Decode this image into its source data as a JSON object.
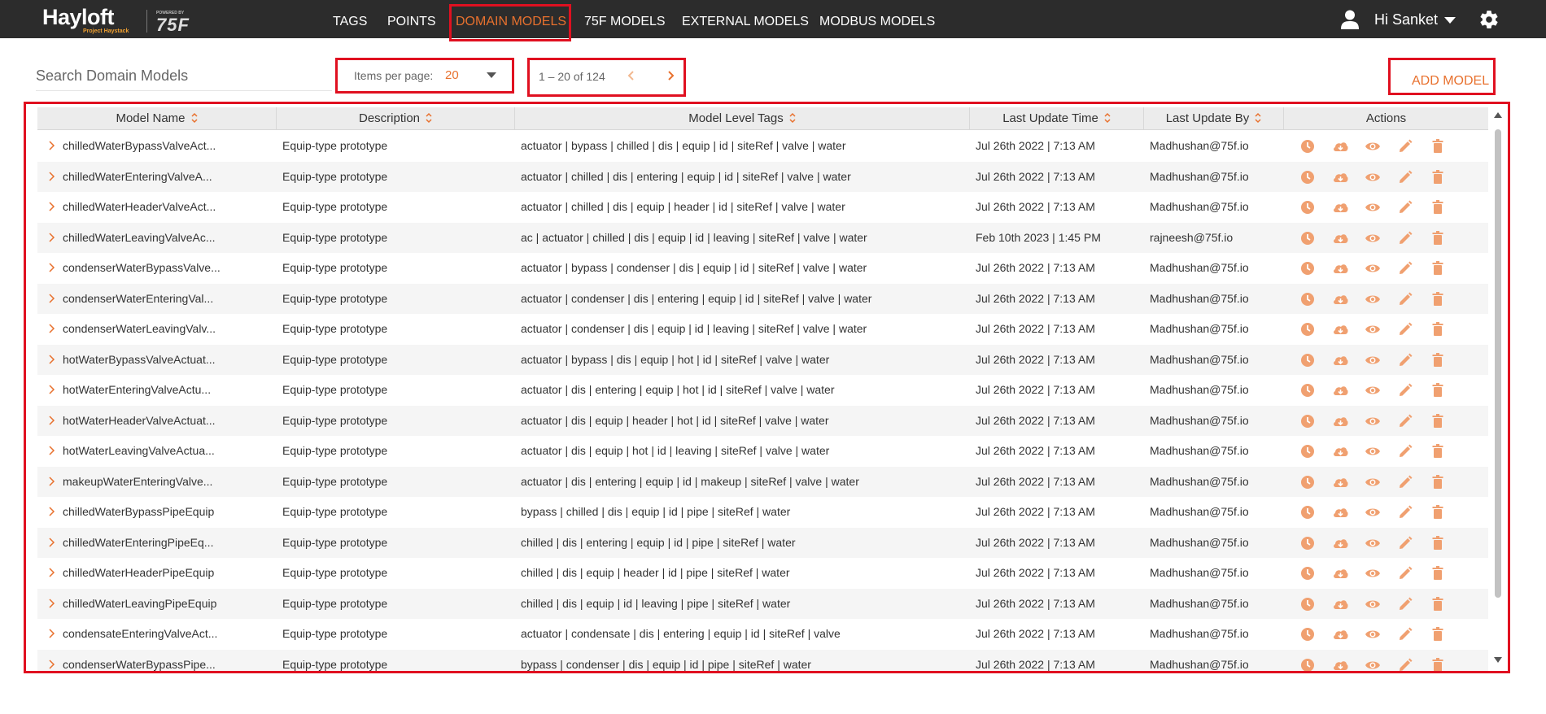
{
  "app": {
    "logo_main": "Hayloft",
    "logo_sub": "Project Haystack",
    "logo_powered": "POWERED BY",
    "logo_brand": "75F"
  },
  "nav": {
    "items": [
      {
        "label": "TAGS",
        "active": false
      },
      {
        "label": "POINTS",
        "active": false
      },
      {
        "label": "DOMAIN MODELS",
        "active": true
      },
      {
        "label": "75F MODELS",
        "active": false
      },
      {
        "label": "EXTERNAL MODELS",
        "active": false
      },
      {
        "label": "MODBUS MODELS",
        "active": false
      }
    ],
    "user_greeting": "Hi Sanket",
    "user_icon": "person-icon",
    "settings_icon": "gear-icon"
  },
  "toolbar": {
    "search_placeholder": "Search Domain Models",
    "items_per_page_label": "Items per page:",
    "items_per_page_value": "20",
    "range_label": "1 – 20 of 124",
    "add_label": "ADD MODEL"
  },
  "colors": {
    "accent": "#e8712e",
    "nav_bg": "#2c2c2c",
    "highlight": "#e01020",
    "row_alt": "#f5f5f5"
  },
  "table": {
    "columns": [
      "Model Name",
      "Description",
      "Model Level Tags",
      "Last Update Time",
      "Last Update By",
      "Actions"
    ],
    "action_icons": [
      "history-icon",
      "download-cloud-icon",
      "view-eye-icon",
      "edit-pencil-icon",
      "delete-trash-icon"
    ],
    "rows": [
      {
        "name": "chilledWaterBypassValveAct...",
        "description": "Equip-type prototype",
        "tags": "actuator | bypass | chilled | dis | equip | id | siteRef | valve | water",
        "time": "Jul 26th 2022 | 7:13 AM",
        "by": "Madhushan@75f.io"
      },
      {
        "name": "chilledWaterEnteringValveA...",
        "description": "Equip-type prototype",
        "tags": "actuator | chilled | dis | entering | equip | id | siteRef | valve | water",
        "time": "Jul 26th 2022 | 7:13 AM",
        "by": "Madhushan@75f.io"
      },
      {
        "name": "chilledWaterHeaderValveAct...",
        "description": "Equip-type prototype",
        "tags": "actuator | chilled | dis | equip | header | id | siteRef | valve | water",
        "time": "Jul 26th 2022 | 7:13 AM",
        "by": "Madhushan@75f.io"
      },
      {
        "name": "chilledWaterLeavingValveAc...",
        "description": "Equip-type prototype",
        "tags": "ac | actuator | chilled | dis | equip | id | leaving | siteRef | valve | water",
        "time": "Feb 10th 2023 | 1:45 PM",
        "by": "rajneesh@75f.io"
      },
      {
        "name": "condenserWaterBypassValve...",
        "description": "Equip-type prototype",
        "tags": "actuator | bypass | condenser | dis | equip | id | siteRef | valve | water",
        "time": "Jul 26th 2022 | 7:13 AM",
        "by": "Madhushan@75f.io"
      },
      {
        "name": "condenserWaterEnteringVal...",
        "description": "Equip-type prototype",
        "tags": "actuator | condenser | dis | entering | equip | id | siteRef | valve | water",
        "time": "Jul 26th 2022 | 7:13 AM",
        "by": "Madhushan@75f.io"
      },
      {
        "name": "condenserWaterLeavingValv...",
        "description": "Equip-type prototype",
        "tags": "actuator | condenser | dis | equip | id | leaving | siteRef | valve | water",
        "time": "Jul 26th 2022 | 7:13 AM",
        "by": "Madhushan@75f.io"
      },
      {
        "name": "hotWaterBypassValveActuat...",
        "description": "Equip-type prototype",
        "tags": "actuator | bypass | dis | equip | hot | id | siteRef | valve | water",
        "time": "Jul 26th 2022 | 7:13 AM",
        "by": "Madhushan@75f.io"
      },
      {
        "name": "hotWaterEnteringValveActu...",
        "description": "Equip-type prototype",
        "tags": "actuator | dis | entering | equip | hot | id | siteRef | valve | water",
        "time": "Jul 26th 2022 | 7:13 AM",
        "by": "Madhushan@75f.io"
      },
      {
        "name": "hotWaterHeaderValveActuat...",
        "description": "Equip-type prototype",
        "tags": "actuator | dis | equip | header | hot | id | siteRef | valve | water",
        "time": "Jul 26th 2022 | 7:13 AM",
        "by": "Madhushan@75f.io"
      },
      {
        "name": "hotWaterLeavingValveActua...",
        "description": "Equip-type prototype",
        "tags": "actuator | dis | equip | hot | id | leaving | siteRef | valve | water",
        "time": "Jul 26th 2022 | 7:13 AM",
        "by": "Madhushan@75f.io"
      },
      {
        "name": "makeupWaterEnteringValve...",
        "description": "Equip-type prototype",
        "tags": "actuator | dis | entering | equip | id | makeup | siteRef | valve | water",
        "time": "Jul 26th 2022 | 7:13 AM",
        "by": "Madhushan@75f.io"
      },
      {
        "name": "chilledWaterBypassPipeEquip",
        "description": "Equip-type prototype",
        "tags": "bypass | chilled | dis | equip | id | pipe | siteRef | water",
        "time": "Jul 26th 2022 | 7:13 AM",
        "by": "Madhushan@75f.io"
      },
      {
        "name": "chilledWaterEnteringPipeEq...",
        "description": "Equip-type prototype",
        "tags": "chilled | dis | entering | equip | id | pipe | siteRef | water",
        "time": "Jul 26th 2022 | 7:13 AM",
        "by": "Madhushan@75f.io"
      },
      {
        "name": "chilledWaterHeaderPipeEquip",
        "description": "Equip-type prototype",
        "tags": "chilled | dis | equip | header | id | pipe | siteRef | water",
        "time": "Jul 26th 2022 | 7:13 AM",
        "by": "Madhushan@75f.io"
      },
      {
        "name": "chilledWaterLeavingPipeEquip",
        "description": "Equip-type prototype",
        "tags": "chilled | dis | equip | id | leaving | pipe | siteRef | water",
        "time": "Jul 26th 2022 | 7:13 AM",
        "by": "Madhushan@75f.io"
      },
      {
        "name": "condensateEnteringValveAct...",
        "description": "Equip-type prototype",
        "tags": "actuator | condensate | dis | entering | equip | id | siteRef | valve",
        "time": "Jul 26th 2022 | 7:13 AM",
        "by": "Madhushan@75f.io"
      },
      {
        "name": "condenserWaterBypassPipe...",
        "description": "Equip-type prototype",
        "tags": "bypass | condenser | dis | equip | id | pipe | siteRef | water",
        "time": "Jul 26th 2022 | 7:13 AM",
        "by": "Madhushan@75f.io"
      }
    ]
  }
}
